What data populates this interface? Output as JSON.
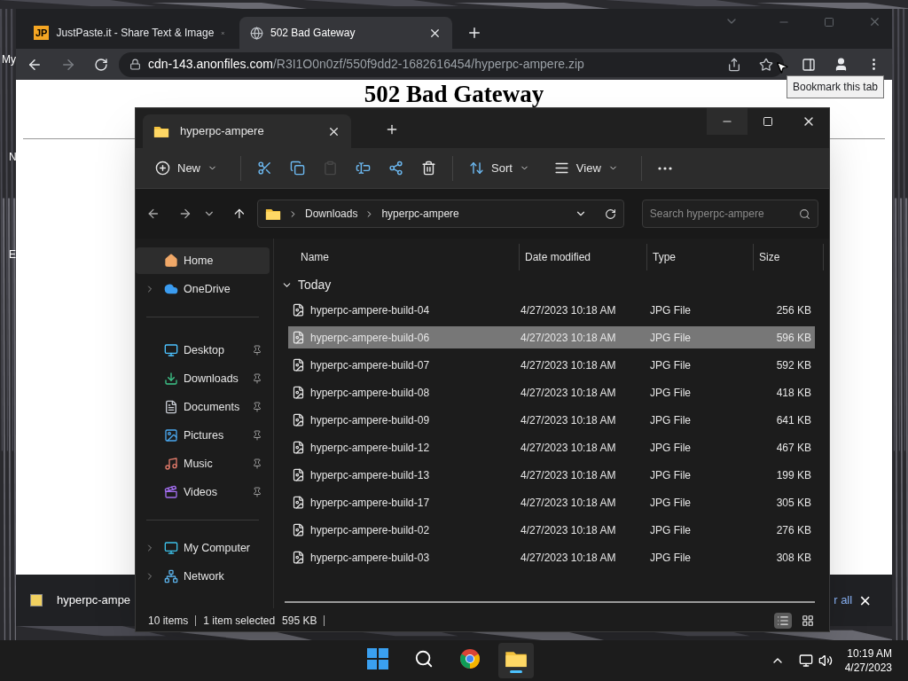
{
  "desktop": {
    "labels": [
      "My",
      "N",
      "E"
    ]
  },
  "browser": {
    "tabs": [
      {
        "icon": "JP",
        "title": "JustPaste.it - Share Text & Image",
        "selected": false
      },
      {
        "title": "502 Bad Gateway",
        "selected": true
      }
    ],
    "url_host": "cdn-143.anonfiles.com",
    "url_path": "/R3I1O0n0zf/550f9dd2-1682616454/hyperpc-ampere.zip",
    "tooltip": "Bookmark this tab",
    "heading": "502 Bad Gateway",
    "download_bar": {
      "file": "hyperpc-ampe",
      "show_all": "r all",
      "close": "×"
    }
  },
  "explorer": {
    "tab": "hyperpc-ampere",
    "toolbar": [
      {
        "kind": "new",
        "label": "New",
        "disabled": false
      },
      {
        "kind": "cut",
        "disabled": false
      },
      {
        "kind": "copy",
        "disabled": false
      },
      {
        "kind": "paste",
        "disabled": true
      },
      {
        "kind": "rename",
        "disabled": false
      },
      {
        "kind": "share",
        "disabled": false
      },
      {
        "kind": "delete",
        "disabled": false
      },
      {
        "kind": "sort",
        "label": "Sort",
        "disabled": false
      },
      {
        "kind": "view",
        "label": "View",
        "disabled": false
      },
      {
        "kind": "more",
        "disabled": false
      }
    ],
    "breadcrumb": [
      "Downloads",
      "hyperpc-ampere"
    ],
    "search": {
      "placeholder": "Search hyperpc-ampere"
    },
    "sidebar": [
      [
        {
          "kind": "home",
          "label": "Home",
          "selected": true,
          "expandable": false,
          "pinned": false
        },
        {
          "kind": "cloud",
          "label": "OneDrive",
          "selected": false,
          "expandable": true,
          "pinned": false
        }
      ],
      [
        {
          "kind": "desktop",
          "label": "Desktop",
          "selected": false,
          "expandable": false,
          "pinned": true
        },
        {
          "kind": "downloads",
          "label": "Downloads",
          "selected": false,
          "expandable": false,
          "pinned": true
        },
        {
          "kind": "documents",
          "label": "Documents",
          "selected": false,
          "expandable": false,
          "pinned": true
        },
        {
          "kind": "pictures",
          "label": "Pictures",
          "selected": false,
          "expandable": false,
          "pinned": true
        },
        {
          "kind": "music",
          "label": "Music",
          "selected": false,
          "expandable": false,
          "pinned": true
        },
        {
          "kind": "videos",
          "label": "Videos",
          "selected": false,
          "expandable": false,
          "pinned": true
        }
      ],
      [
        {
          "kind": "computer",
          "label": "My Computer",
          "selected": false,
          "expandable": true,
          "pinned": false
        },
        {
          "kind": "network",
          "label": "Network",
          "selected": false,
          "expandable": true,
          "pinned": false
        }
      ]
    ],
    "columns": [
      "Name",
      "Date modified",
      "Type",
      "Size"
    ],
    "group": {
      "label": "Today",
      "expanded": true
    },
    "rows": [
      {
        "name": "hyperpc-ampere-build-04",
        "date": "4/27/2023 10:18 AM",
        "type": "JPG File",
        "size": "256 KB",
        "selected": false
      },
      {
        "name": "hyperpc-ampere-build-06",
        "date": "4/27/2023 10:18 AM",
        "type": "JPG File",
        "size": "596 KB",
        "selected": true
      },
      {
        "name": "hyperpc-ampere-build-07",
        "date": "4/27/2023 10:18 AM",
        "type": "JPG File",
        "size": "592 KB",
        "selected": false
      },
      {
        "name": "hyperpc-ampere-build-08",
        "date": "4/27/2023 10:18 AM",
        "type": "JPG File",
        "size": "418 KB",
        "selected": false
      },
      {
        "name": "hyperpc-ampere-build-09",
        "date": "4/27/2023 10:18 AM",
        "type": "JPG File",
        "size": "641 KB",
        "selected": false
      },
      {
        "name": "hyperpc-ampere-build-12",
        "date": "4/27/2023 10:18 AM",
        "type": "JPG File",
        "size": "467 KB",
        "selected": false
      },
      {
        "name": "hyperpc-ampere-build-13",
        "date": "4/27/2023 10:18 AM",
        "type": "JPG File",
        "size": "199 KB",
        "selected": false
      },
      {
        "name": "hyperpc-ampere-build-17",
        "date": "4/27/2023 10:18 AM",
        "type": "JPG File",
        "size": "305 KB",
        "selected": false
      },
      {
        "name": "hyperpc-ampere-build-02",
        "date": "4/27/2023 10:18 AM",
        "type": "JPG File",
        "size": "276 KB",
        "selected": false
      },
      {
        "name": "hyperpc-ampere-build-03",
        "date": "4/27/2023 10:18 AM",
        "type": "JPG File",
        "size": "308 KB",
        "selected": false
      }
    ],
    "status": {
      "count": "10 items",
      "selection": "1 item selected",
      "size": "595 KB"
    },
    "views": [
      {
        "kind": "details",
        "selected": true
      },
      {
        "kind": "tiles",
        "selected": false
      }
    ]
  },
  "taskbar": {
    "apps": [
      {
        "kind": "start",
        "active": false
      },
      {
        "kind": "search",
        "active": false
      },
      {
        "kind": "chrome",
        "active": false
      },
      {
        "kind": "explorer",
        "active": true
      }
    ],
    "time": "10:19 AM",
    "date": "4/27/2023"
  }
}
